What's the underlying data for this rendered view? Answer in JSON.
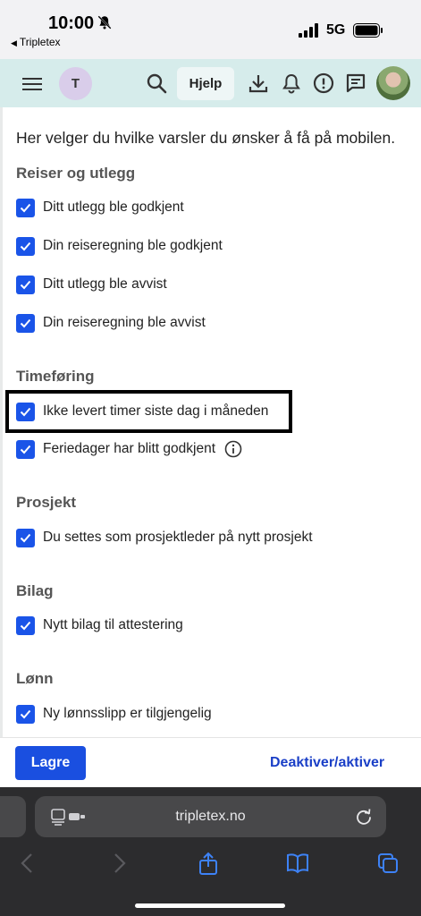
{
  "status_bar": {
    "time": "10:00",
    "back_app": "Tripletex",
    "network": "5G"
  },
  "header": {
    "user_initial": "T",
    "help_label": "Hjelp",
    "icons": [
      "menu-icon",
      "search-icon",
      "download-icon",
      "bell-icon",
      "alert-icon",
      "chat-icon"
    ]
  },
  "content": {
    "intro": "Her velger du hvilke varsler du ønsker å få på mobilen.",
    "sections": [
      {
        "title": "Reiser og utlegg",
        "items": [
          {
            "label": "Ditt utlegg ble godkjent",
            "checked": true
          },
          {
            "label": "Din reiseregning ble godkjent",
            "checked": true
          },
          {
            "label": "Ditt utlegg ble avvist",
            "checked": true
          },
          {
            "label": "Din reiseregning ble avvist",
            "checked": true
          }
        ]
      },
      {
        "title": "Timeføring",
        "items": [
          {
            "label": "Ikke levert timer siste dag i måneden",
            "checked": true
          },
          {
            "label": "Feriedager har blitt godkjent",
            "checked": true
          }
        ]
      },
      {
        "title": "Prosjekt",
        "items": [
          {
            "label": "Du settes som prosjektleder på nytt prosjekt",
            "checked": true
          }
        ]
      },
      {
        "title": "Bilag",
        "items": [
          {
            "label": "Nytt bilag til attestering",
            "checked": true
          }
        ]
      },
      {
        "title": "Lønn",
        "items": [
          {
            "label": "Ny lønnsslipp er tilgjengelig",
            "checked": true
          }
        ]
      }
    ]
  },
  "actions": {
    "save_label": "Lagre",
    "toggle_label": "Deaktiver/aktiver"
  },
  "browser": {
    "url": "tripletex.no"
  },
  "colors": {
    "header_bg": "#d6eceb",
    "checkbox": "#1a54e8",
    "primary_button": "#1a4fe0",
    "link": "#1a3fc7"
  }
}
